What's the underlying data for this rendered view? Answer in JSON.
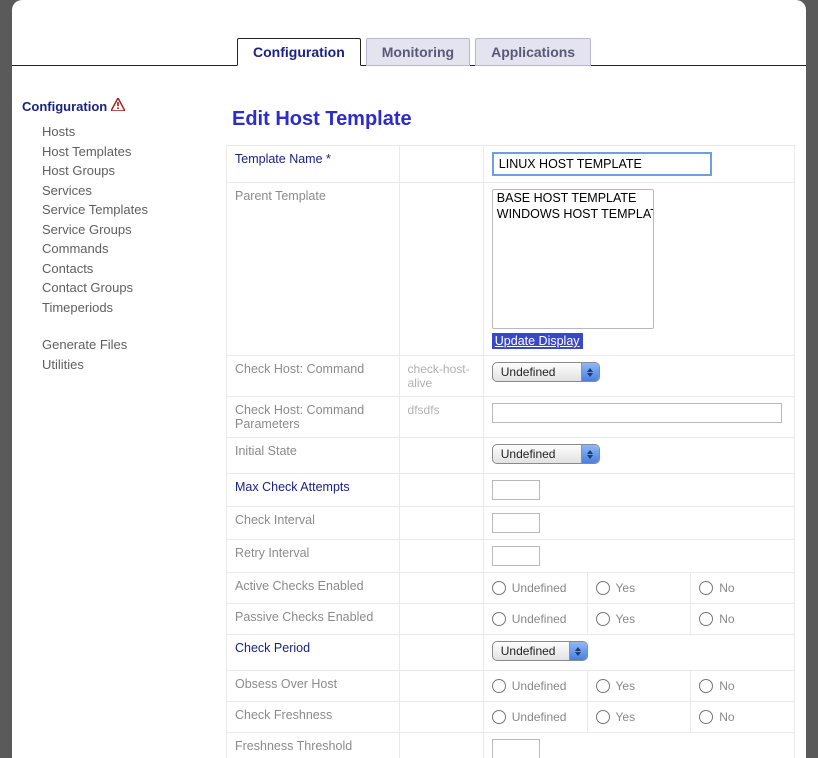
{
  "tabs": {
    "configuration": "Configuration",
    "monitoring": "Monitoring",
    "applications": "Applications"
  },
  "sidebar": {
    "title": "Configuration",
    "items": [
      "Hosts",
      "Host Templates",
      "Host Groups",
      "Services",
      "Service Templates",
      "Service Groups",
      "Commands",
      "Contacts",
      "Contact Groups",
      "Timeperiods"
    ],
    "items2": [
      "Generate Files",
      "Utilities"
    ]
  },
  "page": {
    "title": "Edit Host Template"
  },
  "form": {
    "template_name_label": "Template Name *",
    "template_name_value": "LINUX HOST TEMPLATE",
    "parent_template_label": "Parent Template",
    "parent_template_options": [
      "BASE HOST TEMPLATE",
      "WINDOWS HOST TEMPLATE"
    ],
    "update_display": "Update Display",
    "check_host_cmd_label": "Check Host: Command",
    "check_host_cmd_inherit": "check-host-alive",
    "check_host_params_label": "Check Host: Command Parameters",
    "check_host_params_inherit": "dfsdfs",
    "initial_state_label": "Initial State",
    "max_check_attempts_label": "Max Check Attempts",
    "check_interval_label": "Check Interval",
    "retry_interval_label": "Retry Interval",
    "active_checks_label": "Active Checks Enabled",
    "passive_checks_label": "Passive Checks Enabled",
    "check_period_label": "Check Period",
    "obsess_label": "Obsess Over Host",
    "check_freshness_label": "Check Freshness",
    "freshness_threshold_label": "Freshness Threshold",
    "select_undefined": "Undefined",
    "radio": {
      "undefined": "Undefined",
      "yes": "Yes",
      "no": "No"
    }
  }
}
